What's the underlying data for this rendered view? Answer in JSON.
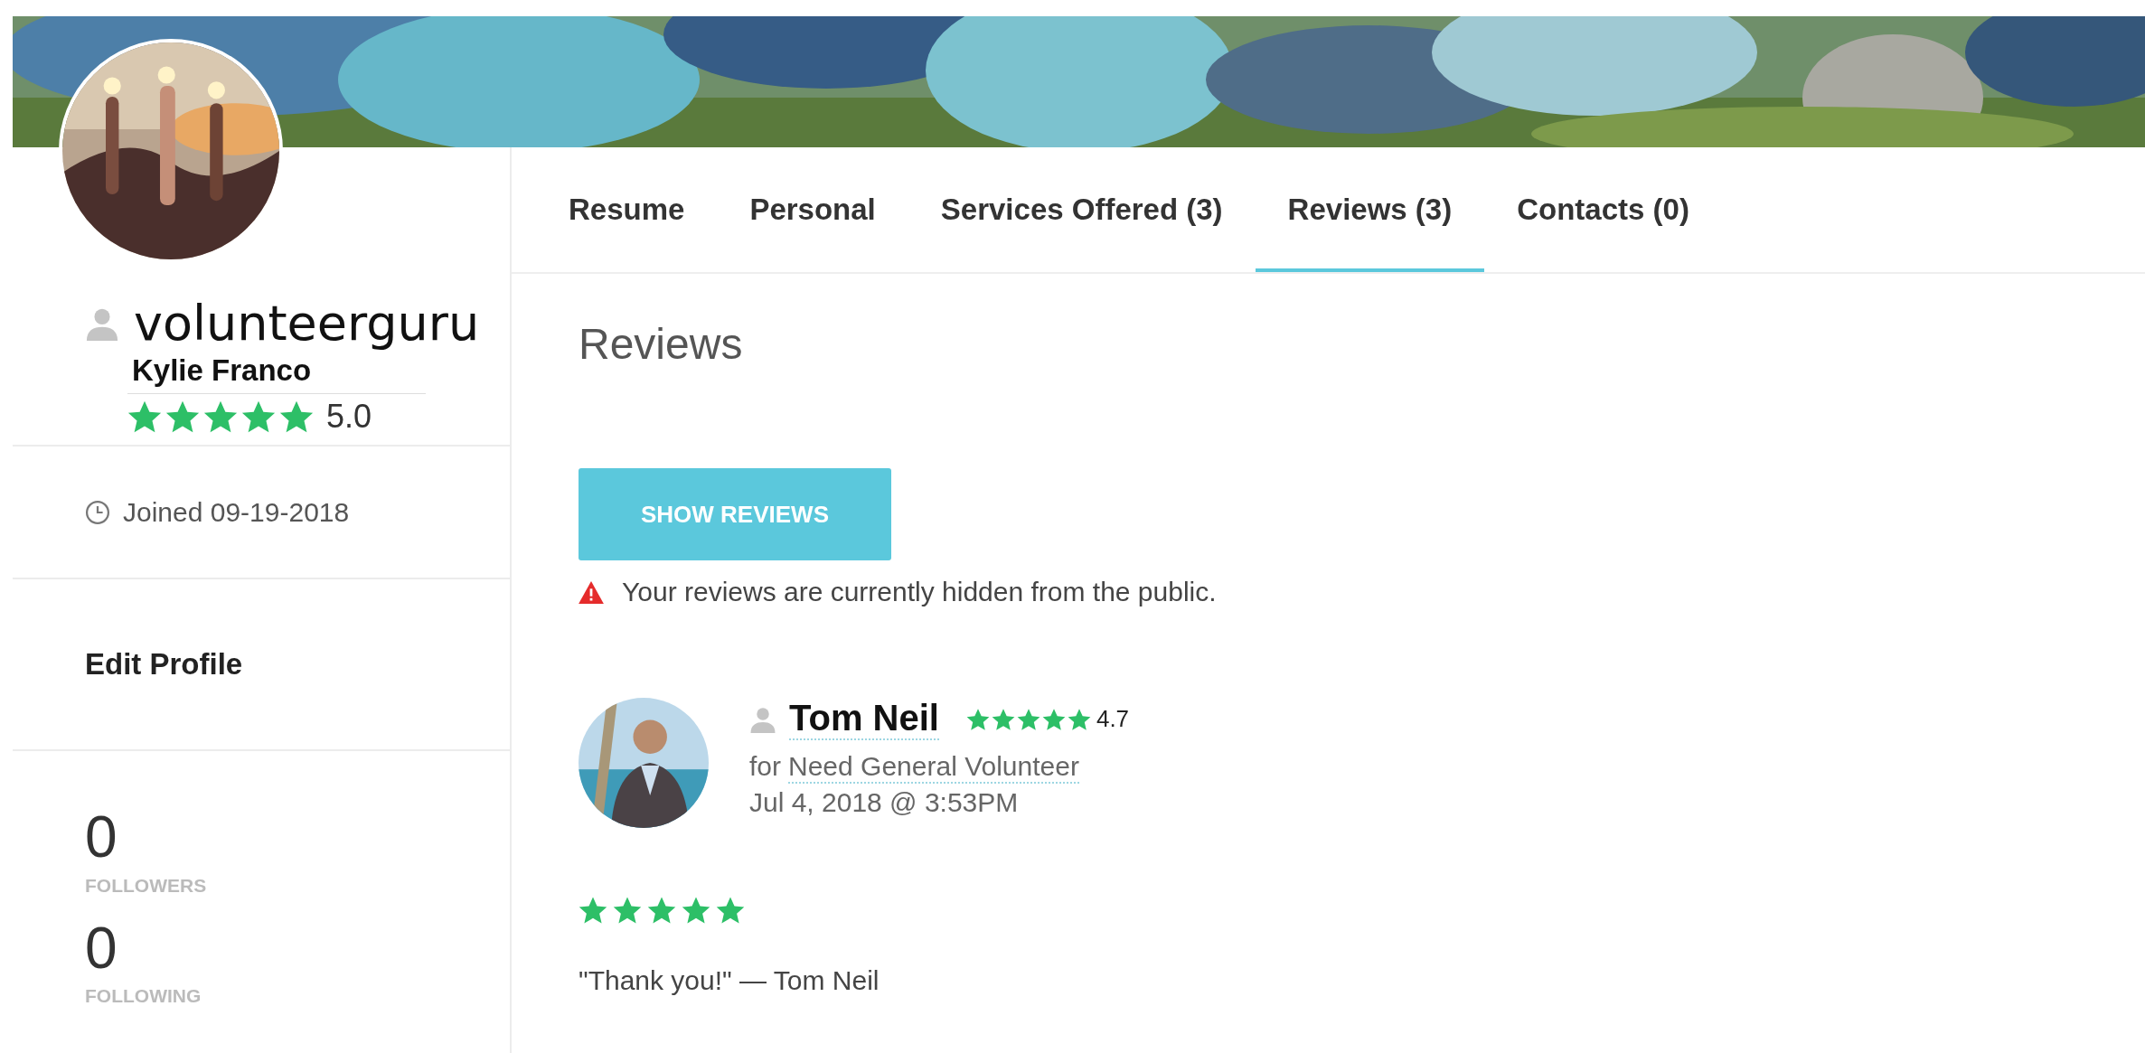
{
  "profile": {
    "username": "volunteerguru",
    "name": "Kylie Franco",
    "stars": 5,
    "rating": "5.0",
    "joined": "Joined 09-19-2018",
    "edit_link": "Edit Profile",
    "stats": [
      {
        "value": "0",
        "label": "FOLLOWERS"
      },
      {
        "value": "0",
        "label": "FOLLOWING"
      }
    ]
  },
  "tabs": [
    {
      "label": "Resume",
      "selected": false
    },
    {
      "label": "Personal",
      "selected": false
    },
    {
      "label": "Services Offered (3)",
      "selected": false
    },
    {
      "label": "Reviews (3)",
      "selected": true
    },
    {
      "label": "Contacts (0)",
      "selected": false
    }
  ],
  "reviews": {
    "title": "Reviews",
    "button": "SHOW REVIEWS",
    "warning": "Your reviews are currently hidden from the public.",
    "items": [
      {
        "reviewer": "Tom Neil",
        "reviewer_rating": {
          "stars": 5,
          "value": "4.7"
        },
        "for_label": "for",
        "listing": "Need General Volunteer",
        "date": "Jul 4, 2018 @ 3:53PM",
        "stars": 5,
        "text": "\"Thank you!\" — Tom Neil"
      }
    ]
  }
}
